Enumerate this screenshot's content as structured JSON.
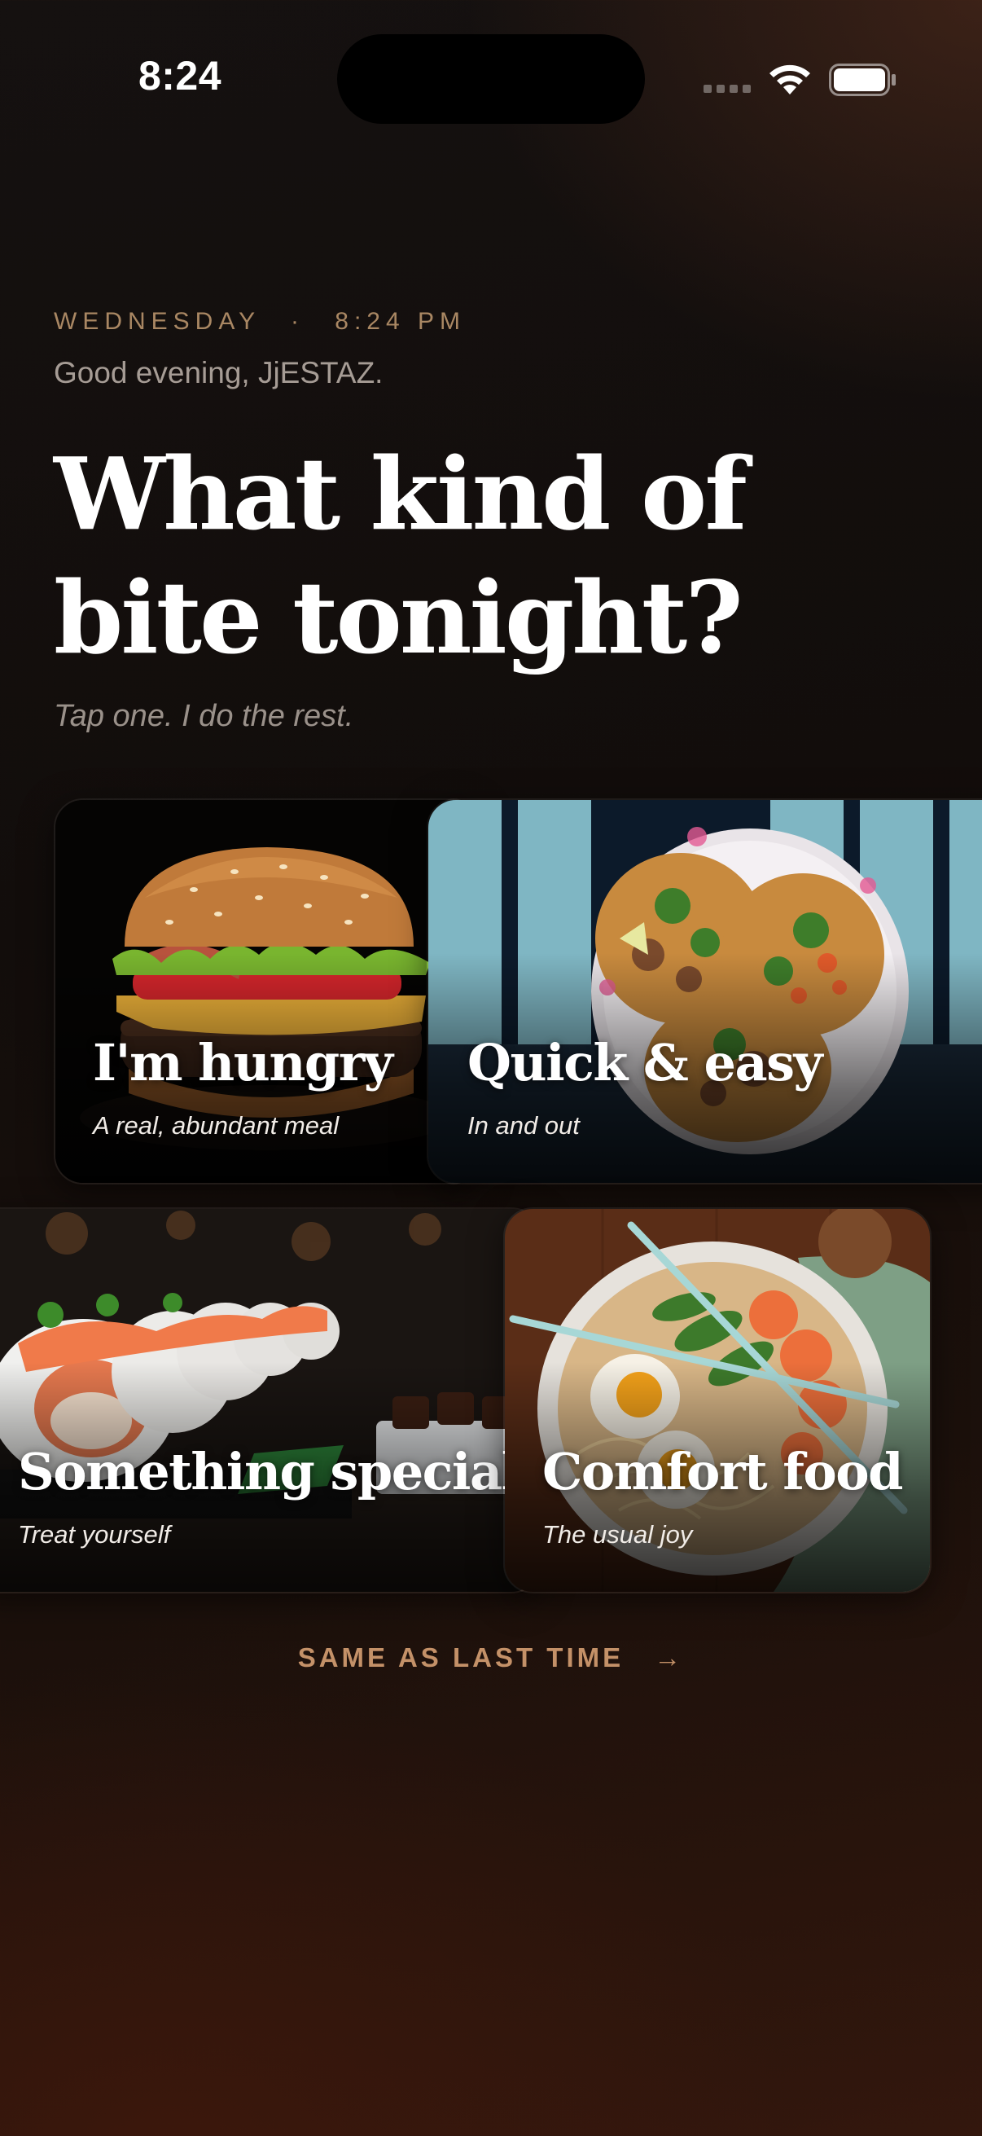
{
  "status_bar": {
    "time": "8:24"
  },
  "header": {
    "day": "WEDNESDAY",
    "separator": "·",
    "time": "8:24 PM",
    "greeting": "Good evening, JjESTAZ.",
    "headline_line1": "What kind of",
    "headline_line2": "bite tonight?",
    "tagline": "Tap one. I do the rest."
  },
  "cards": [
    {
      "title": "I'm hungry",
      "subtitle": "A real, abundant meal",
      "image": "burger"
    },
    {
      "title": "Quick & easy",
      "subtitle": "In and out",
      "image": "tacos"
    },
    {
      "title": "Something special",
      "subtitle": "Treat yourself",
      "image": "sushi"
    },
    {
      "title": "Comfort food",
      "subtitle": "The usual joy",
      "image": "ramen"
    }
  ],
  "footer": {
    "same_label": "SAME AS LAST TIME",
    "arrow": "→"
  },
  "colors": {
    "accent": "#c49168",
    "meta": "#a98763",
    "background": "#140f0d"
  }
}
